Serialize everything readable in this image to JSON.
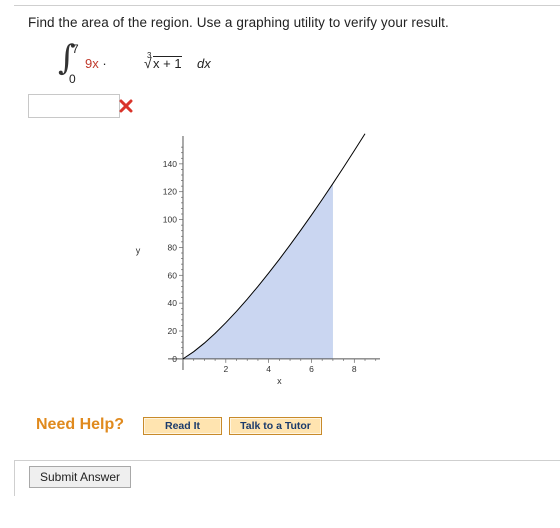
{
  "question": {
    "text": "Find the area of the region. Use a graphing utility to verify your result."
  },
  "integral": {
    "upper": "7",
    "lower": "0",
    "coefficient": "9x",
    "dot": "·",
    "root_index": "3",
    "radicand": "x + 1",
    "differential": "dx"
  },
  "answer": {
    "value": "",
    "status": "incorrect"
  },
  "chart_data": {
    "type": "area",
    "function": "9x·∛(x+1)",
    "shaded_interval": [
      0,
      7
    ],
    "x": [
      0,
      0.5,
      1,
      1.5,
      2,
      2.5,
      3,
      3.5,
      4,
      4.5,
      5,
      5.5,
      6,
      6.5,
      7,
      7.5,
      8,
      8.5
    ],
    "y": [
      0,
      5.15,
      11.34,
      18.32,
      25.96,
      34.16,
      42.86,
      52.01,
      61.56,
      71.49,
      81.77,
      92.36,
      103.25,
      114.42,
      125.86,
      137.55,
      149.48,
      161.63
    ],
    "xlabel": "x",
    "ylabel": "y",
    "xticks": [
      "2",
      "4",
      "6",
      "8"
    ],
    "yticks": [
      "0",
      "20",
      "40",
      "60",
      "80",
      "100",
      "120",
      "140"
    ],
    "xlim": [
      -0.7,
      9.2
    ],
    "ylim": [
      -8,
      160
    ],
    "grid": false,
    "fill_color": "#c5d3ef",
    "line_color": "#000000"
  },
  "help": {
    "label": "Need Help?",
    "read_it": "Read It",
    "talk_to_tutor": "Talk to a Tutor"
  },
  "submit": {
    "label": "Submit Answer"
  }
}
